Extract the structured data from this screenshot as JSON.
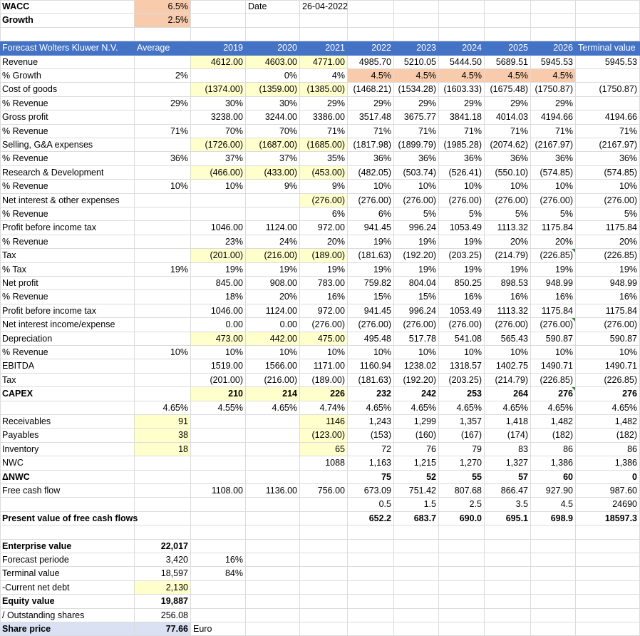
{
  "top": [
    {
      "label": "WACC",
      "value": "6.5%",
      "date_label": "Date",
      "date_value": "26-04-2022"
    },
    {
      "label": "Growth",
      "value": "2.5%"
    }
  ],
  "header": [
    "Forecast Wolters Kluwer N.V.",
    "Average",
    "2019",
    "2020",
    "2021",
    "2022",
    "2023",
    "2024",
    "2025",
    "2026",
    "Terminal value"
  ],
  "rows": [
    {
      "label": "Revenue",
      "cells": [
        "",
        "4612.00",
        "4603.00",
        "4771.00",
        "4985.70",
        "5210.05",
        "5444.50",
        "5689.51",
        "5945.53",
        "5945.53"
      ],
      "hl": {
        "1": "y",
        "2": "y",
        "3": "y"
      }
    },
    {
      "label": "% Growth",
      "cells": [
        "2%",
        "",
        "0%",
        "4%",
        "4.5%",
        "4.5%",
        "4.5%",
        "4.5%",
        "4.5%",
        ""
      ],
      "hl": {
        "4": "o",
        "5": "o",
        "6": "o",
        "7": "o",
        "8": "o"
      }
    },
    {
      "label": "Cost of goods",
      "cells": [
        "",
        "(1374.00)",
        "(1359.00)",
        "(1385.00)",
        "(1468.21)",
        "(1534.28)",
        "(1603.33)",
        "(1675.48)",
        "(1750.87)",
        "(1750.87)"
      ],
      "hl": {
        "1": "y",
        "2": "y",
        "3": "y"
      }
    },
    {
      "label": "% Revenue",
      "cells": [
        "29%",
        "30%",
        "30%",
        "29%",
        "29%",
        "29%",
        "29%",
        "29%",
        "29%",
        ""
      ]
    },
    {
      "label": "Gross profit",
      "cells": [
        "",
        "3238.00",
        "3244.00",
        "3386.00",
        "3517.48",
        "3675.77",
        "3841.18",
        "4014.03",
        "4194.66",
        "4194.66"
      ]
    },
    {
      "label": "% Revenue",
      "cells": [
        "71%",
        "70%",
        "70%",
        "71%",
        "71%",
        "71%",
        "71%",
        "71%",
        "71%",
        "71%"
      ]
    },
    {
      "label": "Selling, G&A expenses",
      "cells": [
        "",
        "(1726.00)",
        "(1687.00)",
        "(1685.00)",
        "(1817.98)",
        "(1899.79)",
        "(1985.28)",
        "(2074.62)",
        "(2167.97)",
        "(2167.97)"
      ],
      "hl": {
        "1": "y",
        "2": "y",
        "3": "y"
      }
    },
    {
      "label": "% Revenue",
      "cells": [
        "36%",
        "37%",
        "37%",
        "35%",
        "36%",
        "36%",
        "36%",
        "36%",
        "36%",
        "36%"
      ]
    },
    {
      "label": "Research & Development",
      "cells": [
        "",
        "(466.00)",
        "(433.00)",
        "(453.00)",
        "(482.05)",
        "(503.74)",
        "(526.41)",
        "(550.10)",
        "(574.85)",
        "(574.85)"
      ],
      "hl": {
        "1": "y",
        "2": "y",
        "3": "y"
      }
    },
    {
      "label": "% Revenue",
      "cells": [
        "10%",
        "10%",
        "9%",
        "9%",
        "10%",
        "10%",
        "10%",
        "10%",
        "10%",
        "10%"
      ]
    },
    {
      "label": "Net interest & other expenses",
      "cells": [
        "",
        "",
        "",
        "(276.00)",
        "(276.00)",
        "(276.00)",
        "(276.00)",
        "(276.00)",
        "(276.00)",
        "(276.00)"
      ],
      "hl": {
        "3": "y"
      }
    },
    {
      "label": "% Revenue",
      "cells": [
        "",
        "",
        "",
        "6%",
        "6%",
        "5%",
        "5%",
        "5%",
        "5%",
        "5%"
      ]
    },
    {
      "label": "Profit before income tax",
      "cells": [
        "",
        "1046.00",
        "1124.00",
        "972.00",
        "941.45",
        "996.24",
        "1053.49",
        "1113.32",
        "1175.84",
        "1175.84"
      ]
    },
    {
      "label": "% Revenue",
      "cells": [
        "",
        "23%",
        "24%",
        "20%",
        "19%",
        "19%",
        "19%",
        "20%",
        "20%",
        "20%"
      ]
    },
    {
      "label": "Tax",
      "cells": [
        "",
        "(201.00)",
        "(216.00)",
        "(189.00)",
        "(181.63)",
        "(192.20)",
        "(203.25)",
        "(214.79)",
        "(226.85)",
        "(226.85)"
      ],
      "hl": {
        "1": "y",
        "2": "y",
        "3": "y"
      },
      "tri": [
        8
      ]
    },
    {
      "label": "% Tax",
      "cells": [
        "19%",
        "19%",
        "19%",
        "19%",
        "19%",
        "19%",
        "19%",
        "19%",
        "19%",
        "19%"
      ]
    },
    {
      "label": "Net profit",
      "cells": [
        "",
        "845.00",
        "908.00",
        "783.00",
        "759.82",
        "804.04",
        "850.25",
        "898.53",
        "948.99",
        "948.99"
      ]
    },
    {
      "label": "% Revenue",
      "cells": [
        "",
        "18%",
        "20%",
        "16%",
        "15%",
        "15%",
        "16%",
        "16%",
        "16%",
        "16%"
      ]
    },
    {
      "label": "Profit before income tax",
      "cells": [
        "",
        "1046.00",
        "1124.00",
        "972.00",
        "941.45",
        "996.24",
        "1053.49",
        "1113.32",
        "1175.84",
        "1175.84"
      ]
    },
    {
      "label": "Net interest income/expense",
      "cells": [
        "",
        "0.00",
        "0.00",
        "(276.00)",
        "(276.00)",
        "(276.00)",
        "(276.00)",
        "(276.00)",
        "(276.00)",
        "(276.00)"
      ],
      "tri": [
        8
      ]
    },
    {
      "label": "Depreciation",
      "cells": [
        "",
        "473.00",
        "442.00",
        "475.00",
        "495.48",
        "517.78",
        "541.08",
        "565.43",
        "590.87",
        "590.87"
      ],
      "hl": {
        "1": "y",
        "2": "y",
        "3": "y"
      }
    },
    {
      "label": "% Revenue",
      "cells": [
        "10%",
        "10%",
        "10%",
        "10%",
        "10%",
        "10%",
        "10%",
        "10%",
        "10%",
        "10%"
      ]
    },
    {
      "label": "EBITDA",
      "cells": [
        "",
        "1519.00",
        "1566.00",
        "1171.00",
        "1160.94",
        "1238.02",
        "1318.57",
        "1402.75",
        "1490.71",
        "1490.71"
      ]
    },
    {
      "label": "Tax",
      "cells": [
        "",
        "(201.00)",
        "(216.00)",
        "(189.00)",
        "(181.63)",
        "(192.20)",
        "(203.25)",
        "(214.79)",
        "(226.85)",
        "(226.85)"
      ]
    },
    {
      "label": "CAPEX",
      "bold": true,
      "cells": [
        "",
        "210",
        "214",
        "226",
        "232",
        "242",
        "253",
        "264",
        "276",
        "276"
      ],
      "hl": {
        "1": "y",
        "2": "y",
        "3": "y"
      },
      "tri": [
        8
      ]
    },
    {
      "label": "",
      "cells": [
        "4.65%",
        "4.55%",
        "4.65%",
        "4.74%",
        "4.65%",
        "4.65%",
        "4.65%",
        "4.65%",
        "4.65%",
        "4.65%"
      ]
    },
    {
      "label": "Receivables",
      "cells": [
        "91",
        "",
        "",
        "1146",
        "1,243",
        "1,299",
        "1,357",
        "1,418",
        "1,482",
        "1,482"
      ],
      "hl": {
        "0": "y",
        "3": "y"
      }
    },
    {
      "label": "Payables",
      "cells": [
        "38",
        "",
        "",
        "(123.00)",
        "(153)",
        "(160)",
        "(167)",
        "(174)",
        "(182)",
        "(182)"
      ],
      "hl": {
        "0": "y",
        "3": "y"
      }
    },
    {
      "label": "Inventory",
      "cells": [
        "18",
        "",
        "",
        "65",
        "72",
        "76",
        "79",
        "83",
        "86",
        "86"
      ],
      "hl": {
        "0": "y",
        "3": "y"
      }
    },
    {
      "label": "NWC",
      "cells": [
        "",
        "",
        "",
        "1088",
        "1,163",
        "1,215",
        "1,270",
        "1,327",
        "1,386",
        "1,386"
      ]
    },
    {
      "label": "ΔNWC",
      "bold": true,
      "cells": [
        "",
        "",
        "",
        "",
        "75",
        "52",
        "55",
        "57",
        "60",
        "0"
      ]
    },
    {
      "label": "Free cash flow",
      "cells": [
        "",
        "1108.00",
        "1136.00",
        "756.00",
        "673.09",
        "751.42",
        "807.68",
        "866.47",
        "927.90",
        "987.60"
      ]
    },
    {
      "label": "",
      "cells": [
        "",
        "",
        "",
        "",
        "0.5",
        "1.5",
        "2.5",
        "3.5",
        "4.5",
        "24690"
      ]
    },
    {
      "label": "Present value of free cash flows",
      "bold": true,
      "cells": [
        "",
        "",
        "",
        "",
        "652.2",
        "683.7",
        "690.0",
        "695.1",
        "698.9",
        "18597.3"
      ]
    }
  ],
  "summary": [
    {
      "label": "Enterprise value",
      "value": "22,017",
      "extra": "",
      "bold": true
    },
    {
      "label": "Forecast periode",
      "value": "3,420",
      "extra": "16%"
    },
    {
      "label": "Terminal value",
      "value": "18,597",
      "extra": "84%"
    },
    {
      "label": "-Current net debt",
      "value": "2,130",
      "extra": "",
      "hl": "y"
    },
    {
      "label": "Equity value",
      "value": "19,887",
      "extra": "",
      "bold": true
    },
    {
      "label": " / Outstanding shares",
      "value": "256.08",
      "extra": ""
    },
    {
      "label": "Share price",
      "value": "77.66",
      "extra": "Euro",
      "bold": true,
      "hl": "b"
    }
  ],
  "colors": {
    "header_bg": "#4472c4",
    "input_yellow": "#ffffcc",
    "input_orange": "#f8cbad",
    "share_price_bg": "#d9e1f2",
    "comment_marker": "#2e8b3a"
  }
}
